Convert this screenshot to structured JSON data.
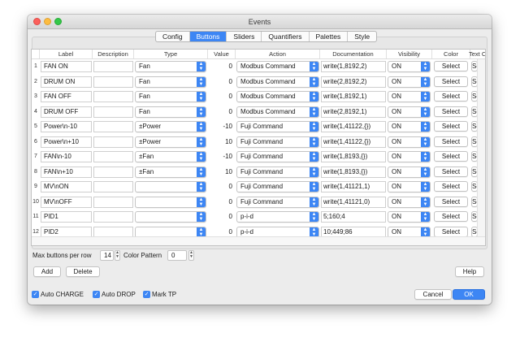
{
  "window": {
    "title": "Events"
  },
  "tabs": [
    {
      "label": "Config",
      "active": false
    },
    {
      "label": "Buttons",
      "active": true
    },
    {
      "label": "Sliders",
      "active": false
    },
    {
      "label": "Quantifiers",
      "active": false
    },
    {
      "label": "Palettes",
      "active": false
    },
    {
      "label": "Style",
      "active": false
    }
  ],
  "table": {
    "headers": [
      "Label",
      "Description",
      "Type",
      "Value",
      "Action",
      "Documentation",
      "Visibility",
      "Color",
      "Text Color"
    ],
    "rows": [
      {
        "num": "1",
        "label": "FAN ON",
        "description": "",
        "type": "Fan",
        "value": "0",
        "action": "Modbus Command",
        "doc": "write(1,8192,2)",
        "visibility": "ON",
        "color": "Select",
        "text_color": "Select"
      },
      {
        "num": "2",
        "label": "DRUM ON",
        "description": "",
        "type": "Fan",
        "value": "0",
        "action": "Modbus Command",
        "doc": "write(2,8192,2)",
        "visibility": "ON",
        "color": "Select",
        "text_color": "Select"
      },
      {
        "num": "3",
        "label": "FAN OFF",
        "description": "",
        "type": "Fan",
        "value": "0",
        "action": "Modbus Command",
        "doc": "write(1,8192,1)",
        "visibility": "ON",
        "color": "Select",
        "text_color": "Select"
      },
      {
        "num": "4",
        "label": "DRUM OFF",
        "description": "",
        "type": "Fan",
        "value": "0",
        "action": "Modbus Command",
        "doc": "write(2,8192,1)",
        "visibility": "ON",
        "color": "Select",
        "text_color": "Select"
      },
      {
        "num": "5",
        "label": "Power\\n-10",
        "description": "",
        "type": "±Power",
        "value": "-10",
        "action": "Fuji Command",
        "doc": "write(1,41122,{})",
        "visibility": "ON",
        "color": "Select",
        "text_color": "Select"
      },
      {
        "num": "6",
        "label": "Power\\n+10",
        "description": "",
        "type": "±Power",
        "value": "10",
        "action": "Fuji Command",
        "doc": "write(1,41122,{})",
        "visibility": "ON",
        "color": "Select",
        "text_color": "Select"
      },
      {
        "num": "7",
        "label": "FAN\\n-10",
        "description": "",
        "type": "±Fan",
        "value": "-10",
        "action": "Fuji Command",
        "doc": "write(1,8193,{})",
        "visibility": "ON",
        "color": "Select",
        "text_color": "Select"
      },
      {
        "num": "8",
        "label": "FAN\\n+10",
        "description": "",
        "type": "±Fan",
        "value": "10",
        "action": "Fuji Command",
        "doc": "write(1,8193,{})",
        "visibility": "ON",
        "color": "Select",
        "text_color": "Select"
      },
      {
        "num": "9",
        "label": "MV\\nON",
        "description": "",
        "type": "",
        "value": "0",
        "action": "Fuji Command",
        "doc": "write(1,41121,1)",
        "visibility": "ON",
        "color": "Select",
        "text_color": "Select"
      },
      {
        "num": "10",
        "label": "MV\\nOFF",
        "description": "",
        "type": "",
        "value": "0",
        "action": "Fuji Command",
        "doc": "write(1,41121,0)",
        "visibility": "ON",
        "color": "Select",
        "text_color": "Select"
      },
      {
        "num": "11",
        "label": "PID1",
        "description": "",
        "type": "",
        "value": "0",
        "action": "p-i-d",
        "doc": "5;160;4",
        "visibility": "ON",
        "color": "Select",
        "text_color": "Select"
      },
      {
        "num": "12",
        "label": "PID2",
        "description": "",
        "type": "",
        "value": "0",
        "action": "p-i-d",
        "doc": "10;449;86",
        "visibility": "ON",
        "color": "Select",
        "text_color": "Select"
      }
    ]
  },
  "controls": {
    "max_buttons_label": "Max buttons per row",
    "max_buttons_value": "14",
    "color_pattern_label": "Color Pattern",
    "color_pattern_value": "0",
    "add": "Add",
    "delete": "Delete",
    "help": "Help"
  },
  "footer": {
    "checkboxes": [
      {
        "label": "Auto CHARGE",
        "checked": true
      },
      {
        "label": "Auto DROP",
        "checked": true
      },
      {
        "label": "Mark TP",
        "checked": true
      }
    ],
    "cancel": "Cancel",
    "ok": "OK"
  },
  "colors": {
    "accent": "#3d86f4"
  }
}
